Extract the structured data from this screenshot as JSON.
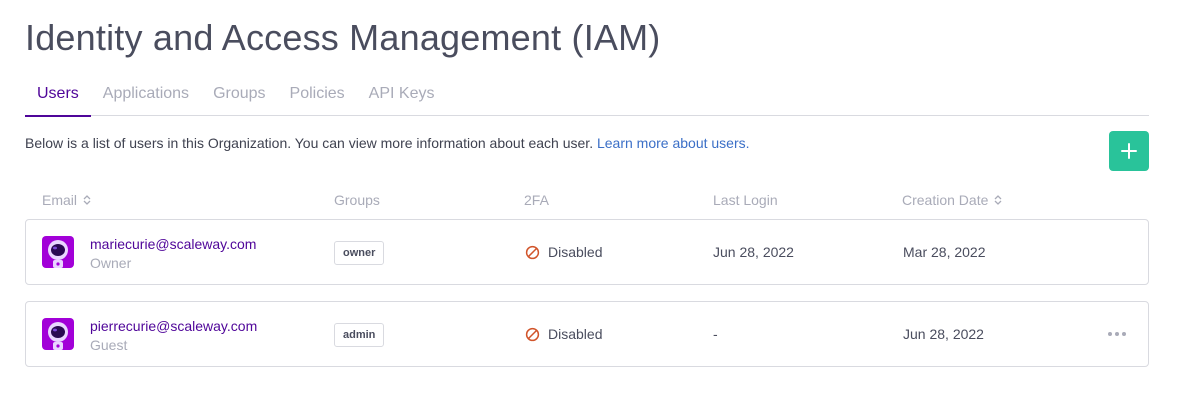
{
  "page": {
    "title": "Identity and Access Management (IAM)"
  },
  "tabs": [
    {
      "label": "Users",
      "active": true
    },
    {
      "label": "Applications",
      "active": false
    },
    {
      "label": "Groups",
      "active": false
    },
    {
      "label": "Policies",
      "active": false
    },
    {
      "label": "API Keys",
      "active": false
    }
  ],
  "description": {
    "text": "Below is a list of users in this Organization. You can view more information about each user. ",
    "link": "Learn more about users."
  },
  "add_button": {
    "icon": "plus-icon"
  },
  "table": {
    "columns": {
      "email": "Email",
      "groups": "Groups",
      "twofa": "2FA",
      "last_login": "Last Login",
      "creation_date": "Creation Date"
    },
    "rows": [
      {
        "email": "mariecurie@scaleway.com",
        "role": "Owner",
        "group": "owner",
        "twofa": "Disabled",
        "last_login": "Jun 28, 2022",
        "creation_date": "Mar 28, 2022"
      },
      {
        "email": "pierrecurie@scaleway.com",
        "role": "Guest",
        "group": "admin",
        "twofa": "Disabled",
        "last_login": "-",
        "creation_date": "Jun 28, 2022"
      }
    ]
  },
  "colors": {
    "accent": "#4f0599",
    "add_button": "#29c39a",
    "avatar_bg": "#a200d8",
    "disabled_icon": "#d1542a",
    "link": "#3b6fc7"
  }
}
